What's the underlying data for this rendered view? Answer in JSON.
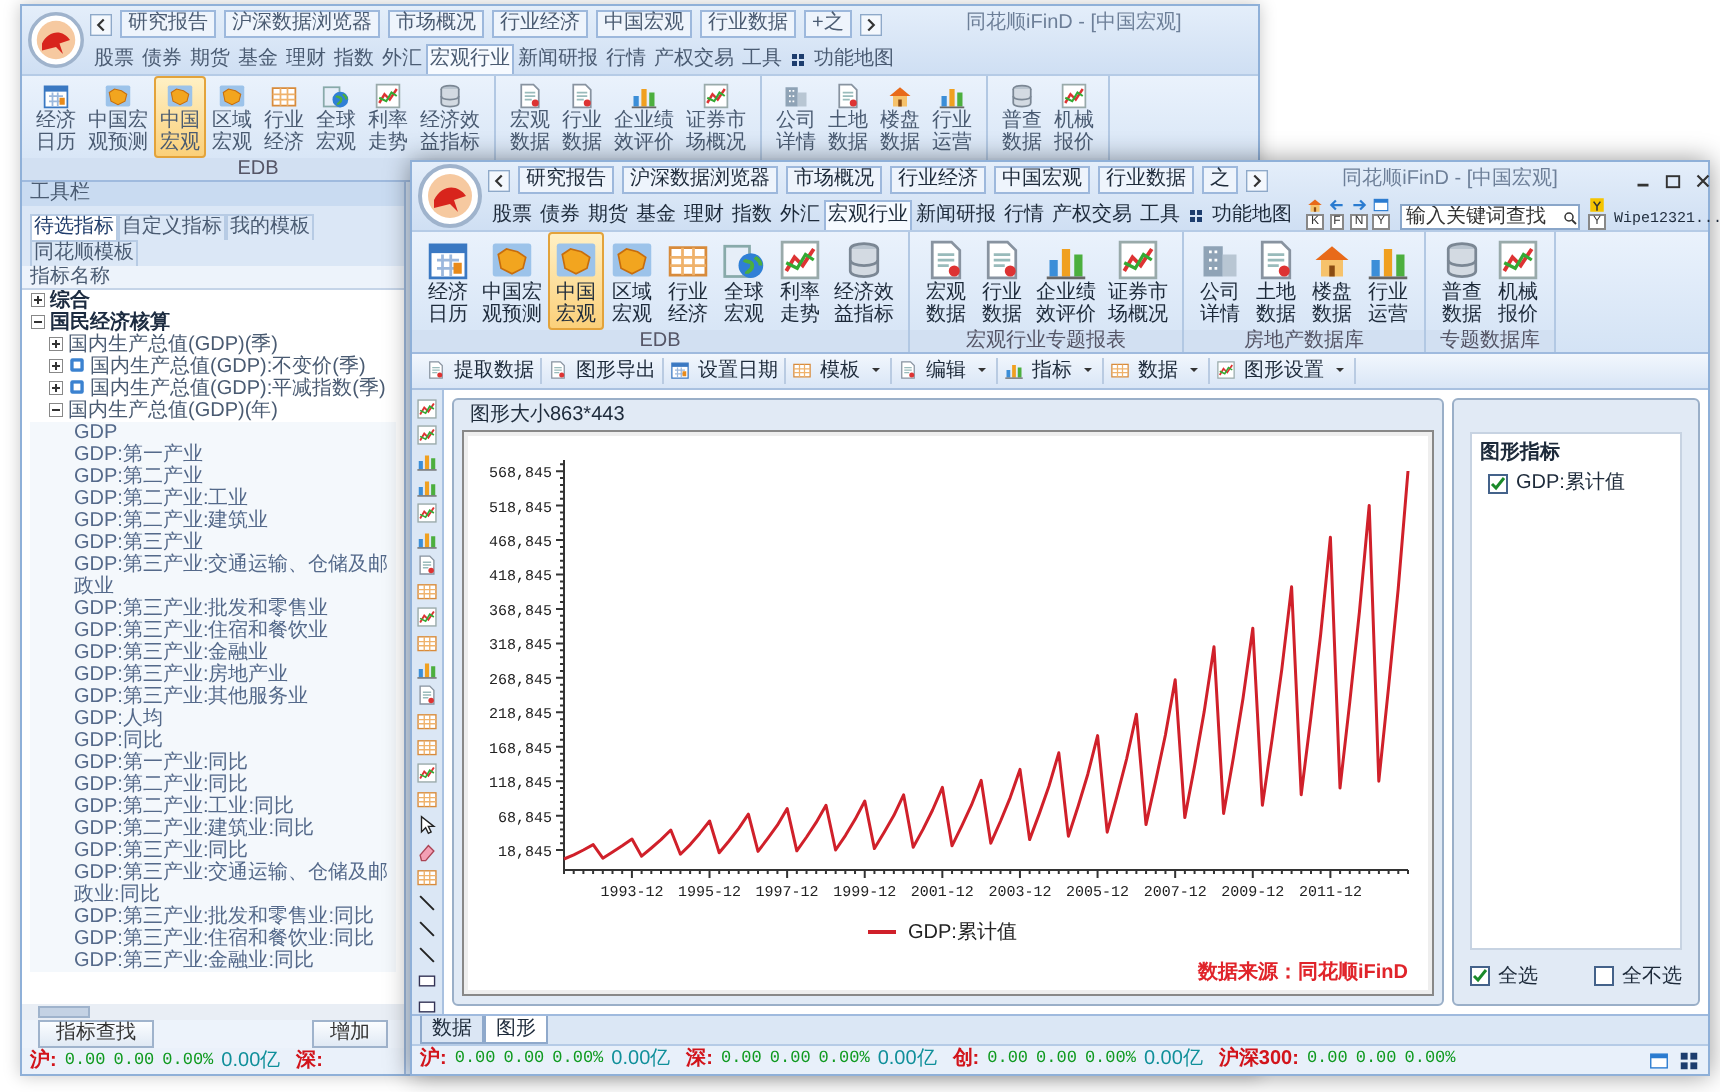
{
  "back_window": {
    "title": "同花顺iFinD - [中国宏观]",
    "quick_tabs": [
      "研究报告",
      "沪深数据浏览器",
      "市场概况",
      "行业经济",
      "中国宏观",
      "行业数据",
      "+之"
    ],
    "menu": [
      {
        "label": "股票",
        "kind": "tab",
        "selected": false
      },
      {
        "label": "债券",
        "kind": "tab",
        "selected": false
      },
      {
        "label": "期货",
        "kind": "tab",
        "selected": false
      },
      {
        "label": "基金",
        "kind": "tab",
        "selected": false
      },
      {
        "label": "理财",
        "kind": "tab",
        "selected": false
      },
      {
        "label": "指数",
        "kind": "tab",
        "selected": false
      },
      {
        "label": "外汇",
        "kind": "tab",
        "selected": false
      },
      {
        "label": "宏观行业",
        "kind": "tab",
        "selected": true
      },
      {
        "label": "新闻研报",
        "kind": "tab",
        "selected": false
      },
      {
        "label": "行情",
        "kind": "tab",
        "selected": false
      },
      {
        "label": "产权交易",
        "kind": "tab",
        "selected": false
      },
      {
        "label": "工具",
        "kind": "tab",
        "selected": false
      },
      {
        "label": "功能地图",
        "kind": "link",
        "selected": false
      }
    ],
    "ribbon_groups": [
      {
        "label": "EDB",
        "buttons": [
          {
            "label": "经济日历",
            "selected": false
          },
          {
            "label": "中国宏观预测",
            "selected": false
          },
          {
            "label": "中国宏观",
            "selected": true
          },
          {
            "label": "区域宏观",
            "selected": false
          },
          {
            "label": "行业经济",
            "selected": false
          },
          {
            "label": "全球宏观",
            "selected": false
          },
          {
            "label": "利率走势",
            "selected": false
          },
          {
            "label": "经济效益指标",
            "selected": false
          }
        ]
      },
      {
        "buttons": [
          {
            "label": "宏观数据",
            "selected": false
          },
          {
            "label": "行业数据",
            "selected": false
          },
          {
            "label": "企业绩效评价",
            "selected": false
          },
          {
            "label": "证券市场概况",
            "selected": false
          }
        ]
      },
      {
        "buttons": [
          {
            "label": "公司详情",
            "selected": false
          },
          {
            "label": "土地数据",
            "selected": false
          },
          {
            "label": "楼盘数据",
            "selected": false
          },
          {
            "label": "行业运营",
            "selected": false
          }
        ]
      },
      {
        "buttons": [
          {
            "label": "普查数据",
            "selected": false
          },
          {
            "label": "机械报价",
            "selected": false
          }
        ]
      }
    ],
    "panel": {
      "title": "工具栏",
      "tabs": [
        {
          "label": "待选指标",
          "selected": true
        },
        {
          "label": "自定义指标",
          "selected": false
        },
        {
          "label": "我的模板",
          "selected": false
        },
        {
          "label": "同花顺模板",
          "selected": false
        }
      ],
      "column": "指标名称",
      "tree": [
        {
          "label": "综合",
          "expanded": false
        },
        {
          "label": "国民经济核算",
          "expanded": true,
          "children": [
            {
              "label": "国内生产总值(GDP)(季)",
              "kind": "plain",
              "expanded": false
            },
            {
              "label": "国内生产总值(GDP):不变价(季)",
              "kind": "tagged",
              "expanded": false
            },
            {
              "label": "国内生产总值(GDP):平减指数(季)",
              "kind": "tagged",
              "expanded": false
            },
            {
              "label": "国内生产总值(GDP)(年)",
              "kind": "plain",
              "expanded": true,
              "children": [
                {
                  "label": "GDP"
                },
                {
                  "label": "GDP:第一产业"
                },
                {
                  "label": "GDP:第二产业"
                },
                {
                  "label": "GDP:第二产业:工业"
                },
                {
                  "label": "GDP:第二产业:建筑业"
                },
                {
                  "label": "GDP:第三产业"
                },
                {
                  "label": "GDP:第三产业:交通运输、仓储及邮政业"
                },
                {
                  "label": "GDP:第三产业:批发和零售业"
                },
                {
                  "label": "GDP:第三产业:住宿和餐饮业"
                },
                {
                  "label": "GDP:第三产业:金融业"
                },
                {
                  "label": "GDP:第三产业:房地产业"
                },
                {
                  "label": "GDP:第三产业:其他服务业"
                },
                {
                  "label": "GDP:人均"
                },
                {
                  "label": "GDP:同比"
                },
                {
                  "label": "GDP:第一产业:同比"
                },
                {
                  "label": "GDP:第二产业:同比"
                },
                {
                  "label": "GDP:第二产业:工业:同比"
                },
                {
                  "label": "GDP:第二产业:建筑业:同比"
                },
                {
                  "label": "GDP:第三产业:同比"
                },
                {
                  "label": "GDP:第三产业:交通运输、仓储及邮政业:同比"
                },
                {
                  "label": "GDP:第三产业:批发和零售业:同比"
                },
                {
                  "label": "GDP:第三产业:住宿和餐饮业:同比"
                },
                {
                  "label": "GDP:第三产业:金融业:同比"
                }
              ]
            }
          ]
        }
      ],
      "buttons": [
        "指标查找",
        "增加"
      ],
      "status": [
        {
          "label": "沪:",
          "values": [
            "0.00",
            "0.00",
            "0.00%"
          ],
          "amount": "0.00亿"
        },
        {
          "label": "深:"
        }
      ]
    }
  },
  "window": {
    "title": "同花顺iFinD - [中国宏观]",
    "quick_tabs": [
      "研究报告",
      "沪深数据浏览器",
      "市场概况",
      "行业经济",
      "中国宏观",
      "行业数据",
      "之"
    ],
    "menu": [
      {
        "label": "股票",
        "kind": "tab",
        "selected": false
      },
      {
        "label": "债券",
        "kind": "tab",
        "selected": false
      },
      {
        "label": "期货",
        "kind": "tab",
        "selected": false
      },
      {
        "label": "基金",
        "kind": "tab",
        "selected": false
      },
      {
        "label": "理财",
        "kind": "tab",
        "selected": false
      },
      {
        "label": "指数",
        "kind": "tab",
        "selected": false
      },
      {
        "label": "外汇",
        "kind": "tab",
        "selected": false
      },
      {
        "label": "宏观行业",
        "kind": "tab",
        "selected": true
      },
      {
        "label": "新闻研报",
        "kind": "tab",
        "selected": false
      },
      {
        "label": "行情",
        "kind": "tab",
        "selected": false
      },
      {
        "label": "产权交易",
        "kind": "tab",
        "selected": false
      },
      {
        "label": "工具",
        "kind": "tab",
        "selected": false
      },
      {
        "label": "功能地图",
        "kind": "link",
        "selected": false
      }
    ],
    "nav_keys": [
      "K",
      "F",
      "N",
      "Y"
    ],
    "search": {
      "placeholder": "输入关键词查找"
    },
    "user": {
      "name": "Wipe12321...",
      "key": "Y"
    },
    "ribbon_groups": [
      {
        "label": "EDB",
        "buttons": [
          {
            "label": "经济日历",
            "selected": false
          },
          {
            "label": "中国宏观预测",
            "selected": false
          },
          {
            "label": "中国宏观",
            "selected": true
          },
          {
            "label": "区域宏观",
            "selected": false
          },
          {
            "label": "行业经济",
            "selected": false
          },
          {
            "label": "全球宏观",
            "selected": false
          },
          {
            "label": "利率走势",
            "selected": false
          },
          {
            "label": "经济效益指标",
            "selected": false
          }
        ]
      },
      {
        "label": "宏观行业专题报表",
        "buttons": [
          {
            "label": "宏观数据",
            "selected": false
          },
          {
            "label": "行业数据",
            "selected": false
          },
          {
            "label": "企业绩效评价",
            "selected": false
          },
          {
            "label": "证券市场概况",
            "selected": false
          }
        ]
      },
      {
        "label": "房地产数据库",
        "buttons": [
          {
            "label": "公司详情",
            "selected": false
          },
          {
            "label": "土地数据",
            "selected": false
          },
          {
            "label": "楼盘数据",
            "selected": false
          },
          {
            "label": "行业运营",
            "selected": false
          }
        ]
      },
      {
        "label": "专题数据库",
        "buttons": [
          {
            "label": "普查数据",
            "selected": false
          },
          {
            "label": "机械报价",
            "selected": false
          }
        ]
      }
    ],
    "toolbar": [
      {
        "label": "提取数据",
        "dropdown": false
      },
      {
        "label": "图形导出",
        "dropdown": false
      },
      {
        "label": "设置日期",
        "dropdown": false
      },
      {
        "label": "模板",
        "dropdown": true
      },
      {
        "label": "编辑",
        "dropdown": true
      },
      {
        "label": "指标",
        "dropdown": true
      },
      {
        "label": "数据",
        "dropdown": true
      },
      {
        "label": "图形设置",
        "dropdown": true
      }
    ],
    "chart_panel": {
      "title": "图形大小863*443",
      "chart_data": {
        "type": "line",
        "categories": [
          null,
          null,
          null,
          null,
          null,
          null,
          null,
          "1993-12",
          null,
          null,
          null,
          null,
          null,
          null,
          null,
          "1995-12",
          null,
          null,
          null,
          null,
          null,
          null,
          null,
          "1997-12",
          null,
          null,
          null,
          null,
          null,
          null,
          null,
          "1999-12",
          null,
          null,
          null,
          null,
          null,
          null,
          null,
          "2001-12",
          null,
          null,
          null,
          null,
          null,
          null,
          null,
          "2003-12",
          null,
          null,
          null,
          null,
          null,
          null,
          null,
          "2005-12",
          null,
          null,
          null,
          null,
          null,
          null,
          null,
          "2007-12",
          null,
          null,
          null,
          null,
          null,
          null,
          null,
          "2009-12",
          null,
          null,
          null,
          null,
          null,
          null,
          null,
          "2011-12",
          null,
          null,
          null,
          null,
          null,
          null,
          null,
          null
        ],
        "series": [
          {
            "name": "GDP:累计值",
            "color": "#d0202a",
            "values": [
              6000,
              12000,
              19000,
              27000,
              7000,
              16000,
              25000,
              35000,
              10000,
              22000,
              34000,
              48000,
              13000,
              27000,
              43000,
              61000,
              15000,
              32000,
              50000,
              71000,
              17000,
              36000,
              55000,
              79000,
              18000,
              38000,
              59000,
              84000,
              19000,
              40000,
              63000,
              90000,
              21000,
              45000,
              69000,
              99000,
              23000,
              49000,
              77000,
              110000,
              25000,
              54000,
              84000,
              120000,
              29000,
              61000,
              95000,
              136000,
              34000,
              72000,
              112000,
              160000,
              39000,
              83000,
              129000,
              185000,
              45000,
              97000,
              151000,
              216000,
              56000,
              120000,
              186000,
              266000,
              66000,
              141000,
              220000,
              314000,
              72000,
              153000,
              239000,
              341000,
              84000,
              181000,
              281000,
              401000,
              99000,
              213000,
              331000,
              473000,
              109000,
              234000,
              364000,
              519000,
              119000,
              256000,
              398000,
              569000
            ]
          }
        ],
        "ylim": [
          -10000,
          585000
        ],
        "yticks": [
          {
            "value": 18845,
            "label": "18,845"
          },
          {
            "value": 68845,
            "label": "68,845"
          },
          {
            "value": 118845,
            "label": "118,845"
          },
          {
            "value": 168845,
            "label": "168,845"
          },
          {
            "value": 218845,
            "label": "218,845"
          },
          {
            "value": 268845,
            "label": "268,845"
          },
          {
            "value": 318845,
            "label": "318,845"
          },
          {
            "value": 368845,
            "label": "368,845"
          },
          {
            "value": 418845,
            "label": "418,845"
          },
          {
            "value": 468845,
            "label": "468,845"
          },
          {
            "value": 518845,
            "label": "518,845"
          },
          {
            "value": 568845,
            "label": "568,845"
          }
        ]
      },
      "source": "数据来源：同花顺iFinD"
    },
    "indicator_panel": {
      "title": "图形指标",
      "items": [
        {
          "label": "GDP:累计值",
          "checked": true
        }
      ],
      "options": [
        {
          "label": "全选",
          "checked": true
        },
        {
          "label": "全不选",
          "checked": false
        }
      ]
    },
    "bottom_tabs": [
      {
        "label": "数据",
        "selected": false
      },
      {
        "label": "图形",
        "selected": true
      }
    ],
    "status": [
      {
        "label": "沪:",
        "values": [
          "0.00",
          "0.00",
          "0.00%"
        ],
        "amount": "0.00亿"
      },
      {
        "label": "深:",
        "values": [
          "0.00",
          "0.00",
          "0.00%"
        ],
        "amount": "0.00亿"
      },
      {
        "label": "创:",
        "values": [
          "0.00",
          "0.00",
          "0.00%"
        ],
        "amount": "0.00亿"
      },
      {
        "label": "沪深300:",
        "values": [
          "0.00",
          "0.00",
          "0.00%"
        ]
      }
    ]
  }
}
